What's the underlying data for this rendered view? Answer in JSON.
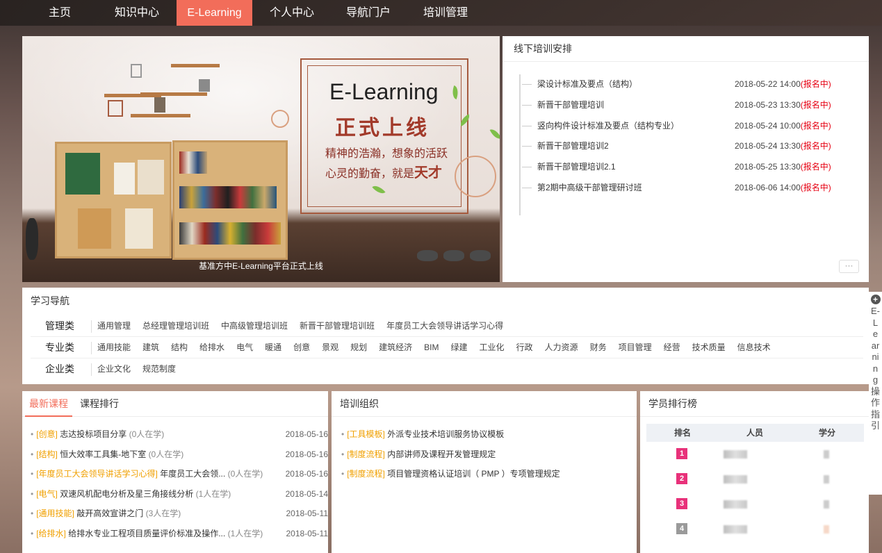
{
  "nav": {
    "items": [
      {
        "label": "主页"
      },
      {
        "label": "知识中心"
      },
      {
        "label": "E-Learning"
      },
      {
        "label": "个人中心"
      },
      {
        "label": "导航门户"
      },
      {
        "label": "培训管理"
      }
    ],
    "active_index": 2
  },
  "banner": {
    "title": "E-Learning",
    "subtitle": "正式上线",
    "line1": "精神的浩瀚，想象的活跃",
    "line2_prefix": "心灵的勤奋，就是",
    "line2_em": "天才",
    "caption": "基准方中E-Learning平台正式上线"
  },
  "offline": {
    "title": "线下培训安排",
    "more": "···",
    "rows": [
      {
        "name": "梁设计标准及要点（结构）",
        "date": "2018-05-22 14:00",
        "status": "(报名中)"
      },
      {
        "name": "新晋干部管理培训",
        "date": "2018-05-23 13:30",
        "status": "(报名中)"
      },
      {
        "name": "竖向构件设计标准及要点（结构专业）",
        "date": "2018-05-24 10:00",
        "status": "(报名中)"
      },
      {
        "name": "新晋干部管理培训2",
        "date": "2018-05-24 13:30",
        "status": "(报名中)"
      },
      {
        "name": "新晋干部管理培训2.1",
        "date": "2018-05-25 13:30",
        "status": "(报名中)"
      },
      {
        "name": "第2期中高级干部管理研讨班",
        "date": "2018-06-06 14:00",
        "status": "(报名中)"
      }
    ]
  },
  "study_nav": {
    "title": "学习导航",
    "rows": [
      {
        "cat": "管理类",
        "links": [
          "通用管理",
          "总经理管理培训班",
          "中高级管理培训班",
          "新晋干部管理培训班",
          "年度员工大会领导讲话学习心得"
        ]
      },
      {
        "cat": "专业类",
        "links": [
          "通用技能",
          "建筑",
          "结构",
          "给排水",
          "电气",
          "暖通",
          "创意",
          "景观",
          "规划",
          "建筑经济",
          "BIM",
          "绿建",
          "工业化",
          "行政",
          "人力资源",
          "财务",
          "项目管理",
          "经营",
          "技术质量",
          "信息技术"
        ]
      },
      {
        "cat": "企业类",
        "links": [
          "企业文化",
          "规范制度"
        ]
      }
    ]
  },
  "courses": {
    "tab_latest": "最新课程",
    "tab_rank": "课程排行",
    "rows": [
      {
        "tag": "[创意]",
        "name": "志达投标项目分享",
        "count": "(0人在学)",
        "date": "2018-05-16"
      },
      {
        "tag": "[结构]",
        "name": "恒大效率工具集-地下室",
        "count": "(0人在学)",
        "date": "2018-05-16"
      },
      {
        "tag": "[年度员工大会领导讲话学习心得]",
        "name": "年度员工大会领...",
        "count": "(0人在学)",
        "date": "2018-05-16"
      },
      {
        "tag": "[电气]",
        "name": "双速风机配电分析及星三角接线分析",
        "count": "(1人在学)",
        "date": "2018-05-14"
      },
      {
        "tag": "[通用技能]",
        "name": "敲开高效宣讲之门",
        "count": "(3人在学)",
        "date": "2018-05-11"
      },
      {
        "tag": "[给排水]",
        "name": "给排水专业工程项目质量评价标准及操作...",
        "count": "(1人在学)",
        "date": "2018-05-11"
      }
    ]
  },
  "org": {
    "title": "培训组织",
    "rows": [
      {
        "tag": "[工具模板]",
        "name": "外派专业技术培训服务协议模板"
      },
      {
        "tag": "[制度流程]",
        "name": "内部讲师及课程开发管理规定"
      },
      {
        "tag": "[制度流程]",
        "name": "项目管理资格认证培训（ PMP ）专项管理规定"
      }
    ]
  },
  "ranking": {
    "title": "学员排行榜",
    "col_rank": "排名",
    "col_person": "人员",
    "col_score": "学分",
    "rows": [
      {
        "rank": "1",
        "color": "#e8317a"
      },
      {
        "rank": "2",
        "color": "#e8317a"
      },
      {
        "rank": "3",
        "color": "#e8317a"
      },
      {
        "rank": "4",
        "color": "#9a9a9a"
      }
    ]
  },
  "side_guide": {
    "icon": "plus-circle-icon",
    "text": "E-Learning操作指引"
  }
}
